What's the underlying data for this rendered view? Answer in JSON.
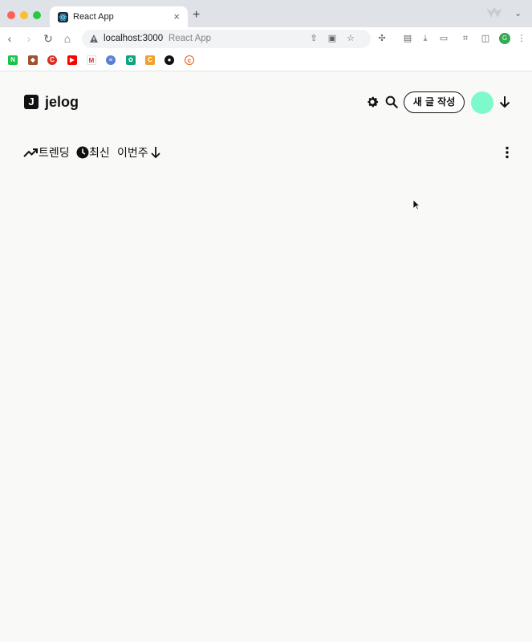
{
  "browser": {
    "tab_title": "React App",
    "url": "localhost:3000",
    "page_title_hint": "React App"
  },
  "header": {
    "brand": "jelog",
    "logo_letter": "J",
    "write_button": "새 글 작성",
    "avatar_color": "#7dfacb"
  },
  "filters": {
    "trending": "트렌딩",
    "latest": "최신",
    "period": "이번주"
  },
  "icons": {
    "theme": "gear-icon",
    "search": "search-icon",
    "menu": "arrow-down-icon",
    "more": "more-vertical-icon"
  }
}
